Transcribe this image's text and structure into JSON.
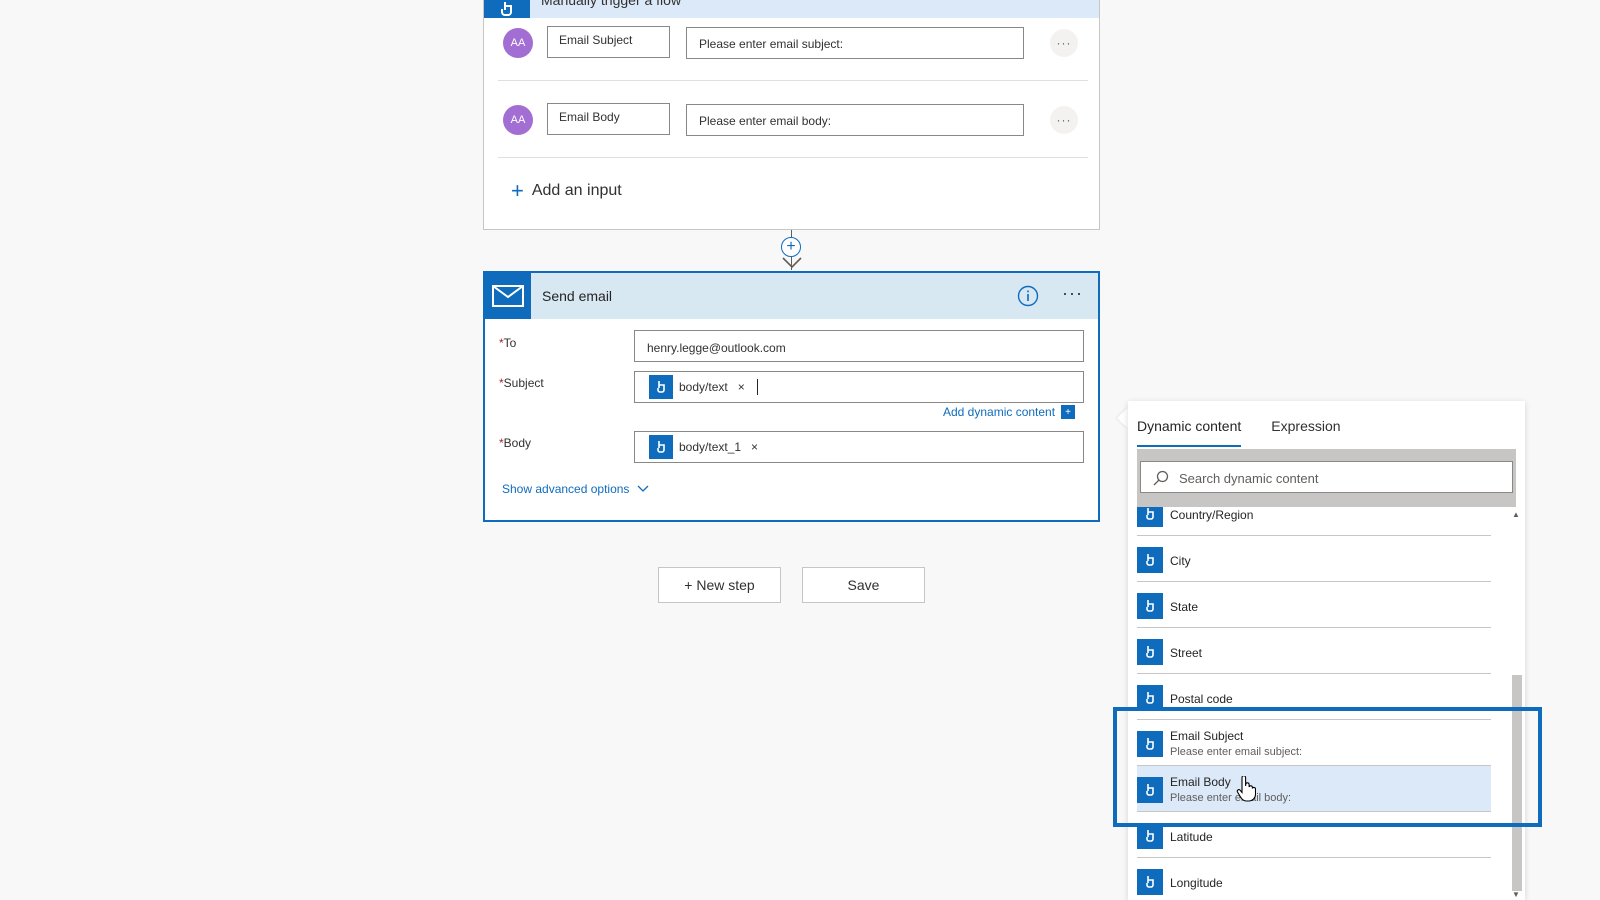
{
  "trigger": {
    "title": "Manually trigger a flow",
    "inputs": [
      {
        "avatar": "AA",
        "name": "Email Subject",
        "description": "Please enter email subject:",
        "more": "···"
      },
      {
        "avatar": "AA",
        "name": "Email Body",
        "description": "Please enter email body:",
        "more": "···"
      }
    ],
    "add_input": "Add an input",
    "add_input_icon": "+"
  },
  "connector": {
    "plus": "+"
  },
  "send_email": {
    "title": "Send email",
    "more": "···",
    "fields": {
      "to_label": "To",
      "to_value": "henry.legge@outlook.com",
      "subject_label": "Subject",
      "subject_token": "body/text",
      "body_label": "Body",
      "body_token": "body/text_1",
      "required_mark": "*",
      "token_close": "×"
    },
    "add_dynamic": "Add dynamic content",
    "add_dynamic_icon": "+",
    "show_advanced": "Show advanced options"
  },
  "buttons": {
    "new_step": "+ New step",
    "save": "Save"
  },
  "dynamic_panel": {
    "tabs": [
      "Dynamic content",
      "Expression"
    ],
    "active_tab": "Dynamic content",
    "search_placeholder": "Search dynamic content",
    "items": [
      {
        "label": "Country/Region"
      },
      {
        "label": "City"
      },
      {
        "label": "State"
      },
      {
        "label": "Street"
      },
      {
        "label": "Postal code"
      },
      {
        "label": "Email Subject",
        "sub": "Please enter email subject:"
      },
      {
        "label": "Email Body",
        "sub": "Please enter email body:"
      },
      {
        "label": "Latitude"
      },
      {
        "label": "Longitude"
      }
    ],
    "scroll_up": "▲",
    "scroll_down": "▼"
  },
  "colors": {
    "accent": "#0f6cbd",
    "avatar": "#a26ed3",
    "hover": "#dbe9f8"
  }
}
